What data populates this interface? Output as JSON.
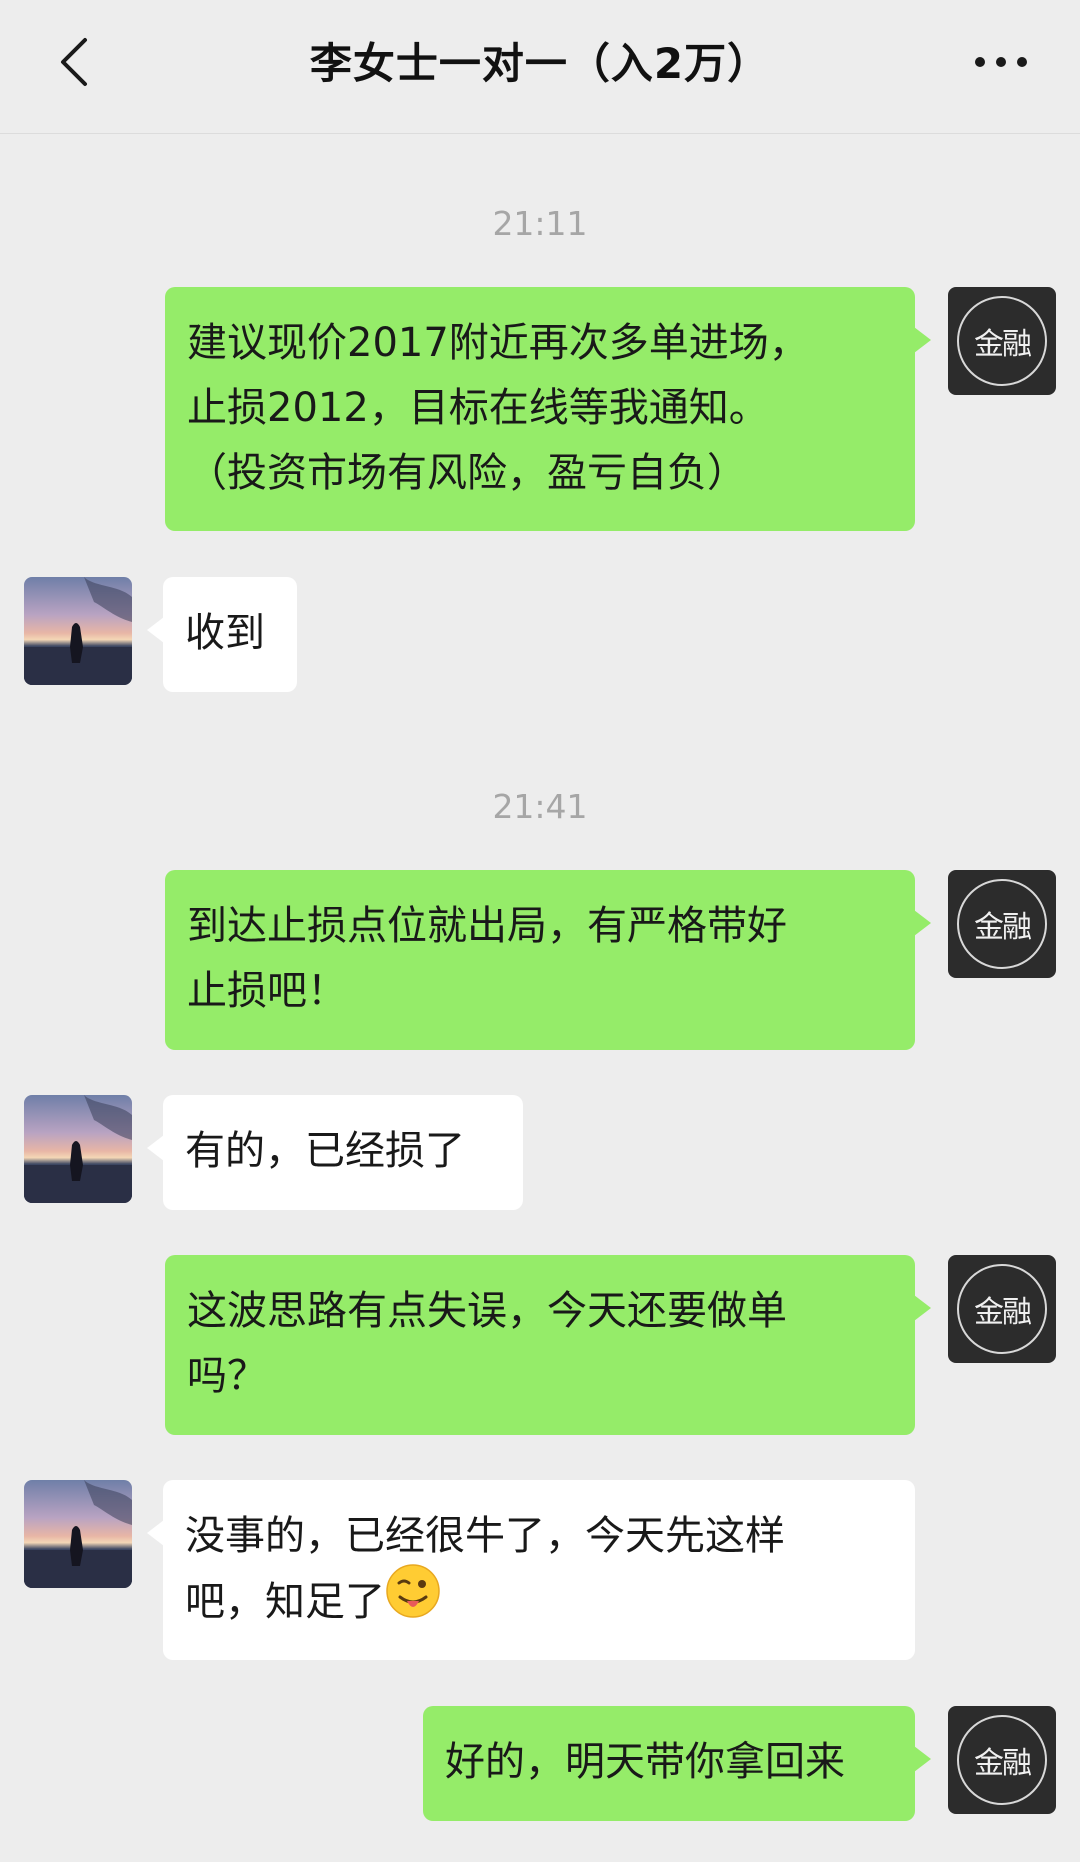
{
  "header": {
    "title": "李女士一对一（入2万）"
  },
  "icons": {
    "back": "chevron-left-icon",
    "more": "more-dots-icon",
    "self_avatar": "jinrong-logo-avatar",
    "other_avatar": "sunset-silhouette-avatar",
    "emoji": "winking-tongue-emoji"
  },
  "colors": {
    "outgoing_bubble": "#95ec69",
    "incoming_bubble": "#ffffff",
    "background": "#ededed",
    "timestamp": "#a6a6a6"
  },
  "self_avatar_text": "金融",
  "timestamps": [
    "21:11",
    "21:41"
  ],
  "messages": [
    {
      "sender": "self",
      "lines": [
        "建议现价2017附近再次多单进场，",
        "止损2012，目标在线等我通知。",
        "（投资市场有风险，盈亏自负）"
      ]
    },
    {
      "sender": "other",
      "lines": [
        "收到"
      ]
    },
    {
      "sender": "self",
      "lines": [
        "到达止损点位就出局，有严格带好",
        "止损吧！"
      ]
    },
    {
      "sender": "other",
      "lines": [
        "有的，已经损了"
      ]
    },
    {
      "sender": "self",
      "lines": [
        "这波思路有点失误，今天还要做单",
        "吗？"
      ]
    },
    {
      "sender": "other",
      "lines": [
        "没事的，已经很牛了，今天先这样",
        "吧，知足了"
      ]
    },
    {
      "sender": "self",
      "lines": [
        "好的，明天带你拿回来"
      ]
    }
  ]
}
